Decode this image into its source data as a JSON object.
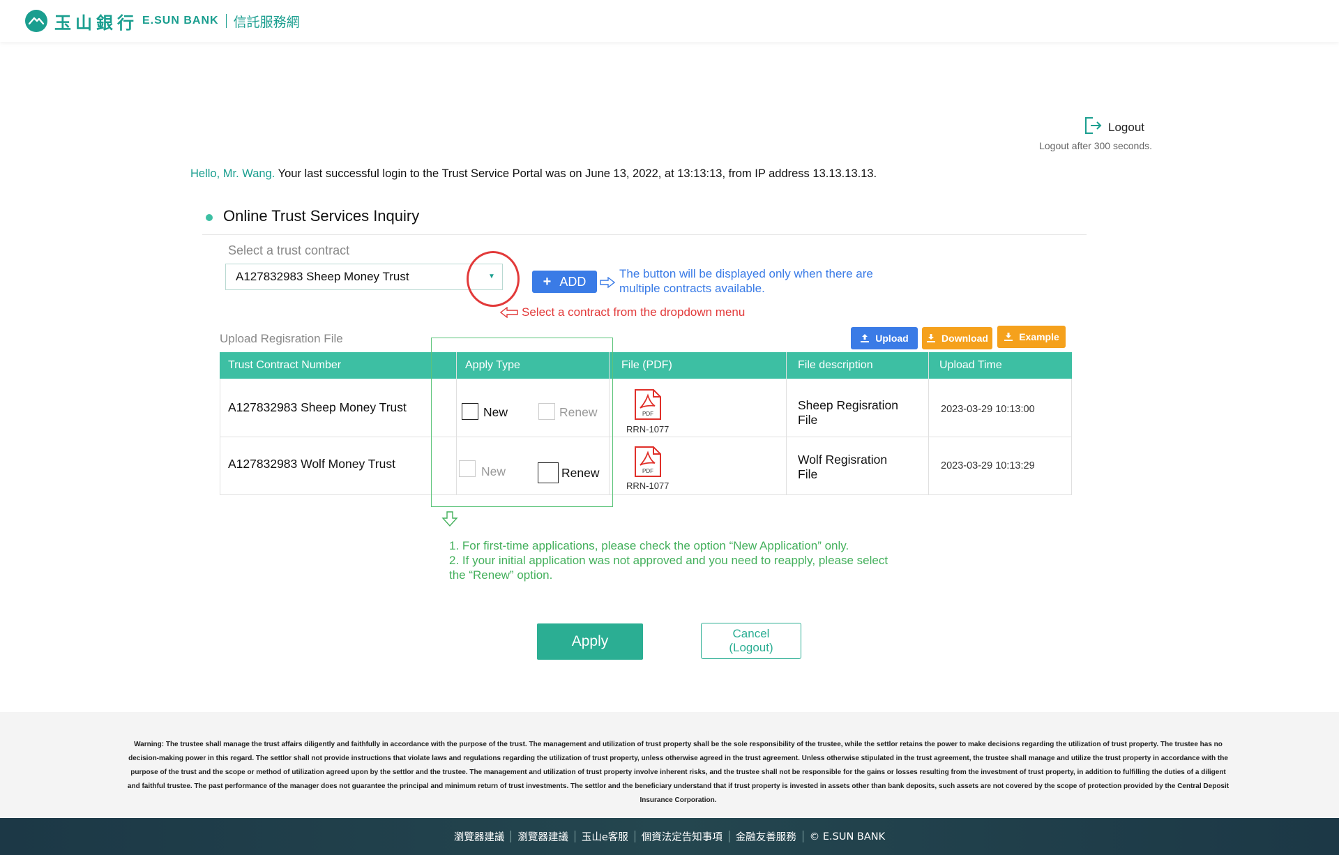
{
  "header": {
    "brand_cn": "玉山銀行",
    "brand_en": "E.SUN BANK",
    "brand_sub": "信託服務網",
    "brand_color": "#1a9e8f"
  },
  "session": {
    "logout_label": "Logout",
    "logout_note": "Logout after 300 seconds.",
    "logout_icon": "logout-icon"
  },
  "greeting": {
    "hello": "Hello, Mr. Wang.",
    "message": " Your last successful login to the Trust Service Portal was on June 13, 2022, at 13:13:13, from IP address 13.13.13.13."
  },
  "section": {
    "title": "Online Trust Services Inquiry"
  },
  "contract_select": {
    "label": "Select a trust contract",
    "value": "A127832983 Sheep Money Trust"
  },
  "add_button": {
    "label": "ADD",
    "color": "#3a7be6"
  },
  "annotations": {
    "add_note": "The button will be displayed only when there are multiple contracts available.",
    "select_note": "Select a contract from the dropdown menu",
    "apply_type_note_1": "1. For first-time applications, please check the option “New Application” only.",
    "apply_type_note_2": "2. If your initial application was not approved and you need to reapply, please select the “Renew” option.",
    "red": "#e23a3a",
    "blue": "#3a7be6",
    "green": "#44b05c"
  },
  "upload": {
    "title": "Upload Regisration File",
    "buttons": {
      "upload": "Upload",
      "download": "Download",
      "example": "Example"
    },
    "columns": [
      "Trust Contract Number",
      "Apply Type",
      "File (PDF)",
      "File description",
      "Upload Time"
    ],
    "rows": [
      {
        "contract": "A127832983 Sheep Money Trust",
        "new_label": "New",
        "renew_label": "Renew",
        "new_enabled": true,
        "renew_enabled": false,
        "file_icon_text": "PDF",
        "file_name": "RRN-1077",
        "description_line1": "Sheep Regisration",
        "description_line2": "File",
        "upload_time": "2023-03-29 10:13:00"
      },
      {
        "contract": "A127832983 Wolf Money Trust",
        "new_label": "New",
        "renew_label": "Renew",
        "new_enabled": false,
        "renew_enabled": true,
        "file_icon_text": "PDF",
        "file_name": "RRN-1077",
        "description_line1": "Wolf Regisration",
        "description_line2": "File",
        "upload_time": "2023-03-29 10:13:29"
      }
    ]
  },
  "actions": {
    "apply": "Apply",
    "cancel_line1": "Cancel",
    "cancel_line2": "(Logout)"
  },
  "footer": {
    "warning": "Warning: The trustee shall manage the trust affairs diligently and faithfully in accordance with the purpose of the trust. The management and utilization of trust property shall be the sole responsibility of the trustee, while the settlor retains the power to make decisions regarding the utilization of trust property. The trustee has no decision-making power in this regard. The settlor shall not provide instructions that violate laws and regulations regarding the utilization of trust property, unless otherwise agreed in the trust agreement. Unless otherwise stipulated in the trust agreement, the trustee shall manage and utilize the trust property in accordance with the purpose of the trust and the scope or method of utilization agreed upon by the settlor and the trustee. The management and utilization of trust property involve inherent risks, and the trustee shall not be responsible for the gains or losses resulting from the investment of trust property, in addition to fulfilling the duties of a diligent and faithful trustee. The past performance of the manager does not guarantee the principal and minimum return of trust investments. The settlor and the beneficiary understand that if trust property is invested in assets other than bank deposits, such assets are not covered by the scope of protection provided by the Central Deposit Insurance Corporation.",
    "links": [
      "瀏覽器建議",
      "瀏覽器建議",
      "玉山e客服",
      "個資法定告知事項",
      "金融友善服務",
      "© E.SUN BANK"
    ]
  }
}
